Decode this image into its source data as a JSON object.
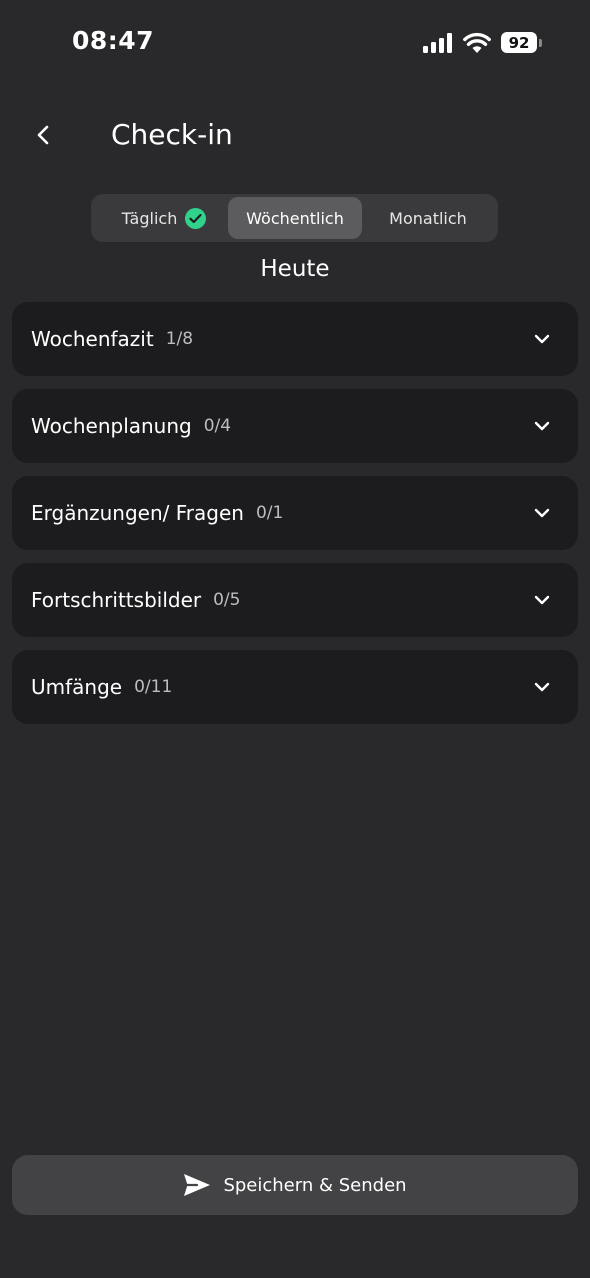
{
  "status_bar": {
    "time": "08:47",
    "battery": "92",
    "icons": [
      "cellular-signal-icon",
      "wifi-icon",
      "battery-icon"
    ]
  },
  "header": {
    "title": "Check-in",
    "back_icon": "chevron-left-icon"
  },
  "tabs": [
    {
      "label": "Täglich",
      "selected": false,
      "completed": true
    },
    {
      "label": "Wöchentlich",
      "selected": true,
      "completed": false
    },
    {
      "label": "Monatlich",
      "selected": false,
      "completed": false
    }
  ],
  "section_title": "Heute",
  "sections": [
    {
      "title": "Wochenfazit",
      "count": "1/8"
    },
    {
      "title": "Wochenplanung",
      "count": "0/4"
    },
    {
      "title": "Ergänzungen/ Fragen",
      "count": "0/1"
    },
    {
      "title": "Fortschrittsbilder",
      "count": "0/5"
    },
    {
      "title": "Umfänge",
      "count": "0/11"
    }
  ],
  "save_button": {
    "label": "Speichern & Senden",
    "icon": "send-icon"
  },
  "colors": {
    "background": "#29292b",
    "card": "#1c1c1e",
    "segment_bg": "#3a3a3c",
    "segment_selected": "#5c5c5e",
    "check_green": "#2fd18b",
    "button_bg": "#434345"
  }
}
